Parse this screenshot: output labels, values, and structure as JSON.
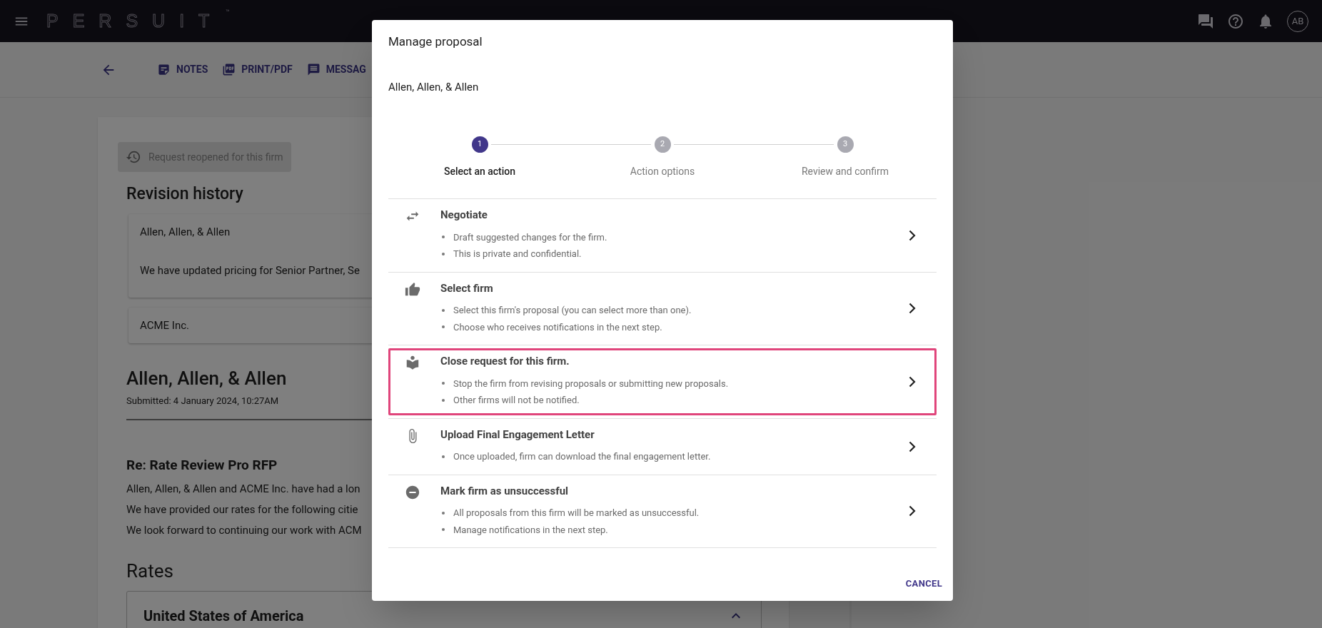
{
  "top_bar": {
    "logo": "PERSUIT",
    "trademark": "™",
    "avatar": "AB"
  },
  "toolbar": {
    "items": [
      {
        "label": "NOTES"
      },
      {
        "label": "PRINT/PDF"
      },
      {
        "label": "MESSAG"
      }
    ]
  },
  "page": {
    "status_chip": "Request reopened for this firm",
    "revision_title": "Revision history",
    "revisions": [
      {
        "author": "Allen, Allen, & Allen",
        "message": "We have updated pricing for Senior Partner, Se"
      },
      {
        "author": "ACME Inc."
      }
    ],
    "firm_title": "Allen, Allen, & Allen",
    "submitted": "Submitted: 4 January 2024, 10:27AM",
    "subject": "Re: Rate Review Pro RFP",
    "paragraphs": [
      "Allen, Allen, & Allen and ACME Inc. have had a lon",
      "We have provided our rates for the following citie",
      "We look forward to continuing our work with ACM"
    ],
    "rates_title": "Rates",
    "rates_section": {
      "title": "United States of America",
      "expanded": true
    }
  },
  "dialog": {
    "title": "Manage proposal",
    "firm": "Allen, Allen, & Allen",
    "steps": [
      {
        "number": "1",
        "label": "Select an action",
        "selected": true
      },
      {
        "number": "2",
        "label": "Action options",
        "selected": false
      },
      {
        "number": "3",
        "label": "Review and confirm",
        "selected": false
      }
    ],
    "actions": [
      {
        "title": "Negotiate",
        "bullets": [
          "Draft suggested changes for the firm.",
          "This is private and confidential."
        ],
        "highlighted": false
      },
      {
        "title": "Select firm",
        "bullets": [
          "Select this firm's proposal (you can select more than one).",
          "Choose who receives notifications in the next step."
        ],
        "highlighted": false
      },
      {
        "title": "Close request for this firm.",
        "bullets": [
          "Stop the firm from revising proposals or submitting new proposals.",
          "Other firms will not be notified."
        ],
        "highlighted": true
      },
      {
        "title": "Upload Final Engagement Letter",
        "bullets": [
          "Once uploaded, firm can download the final engagement letter."
        ],
        "highlighted": false
      },
      {
        "title": "Mark firm as unsuccessful",
        "bullets": [
          "All proposals from this firm will be marked as unsuccessful.",
          "Manage notifications in the next step."
        ],
        "highlighted": false
      }
    ],
    "cancel": "CANCEL"
  }
}
